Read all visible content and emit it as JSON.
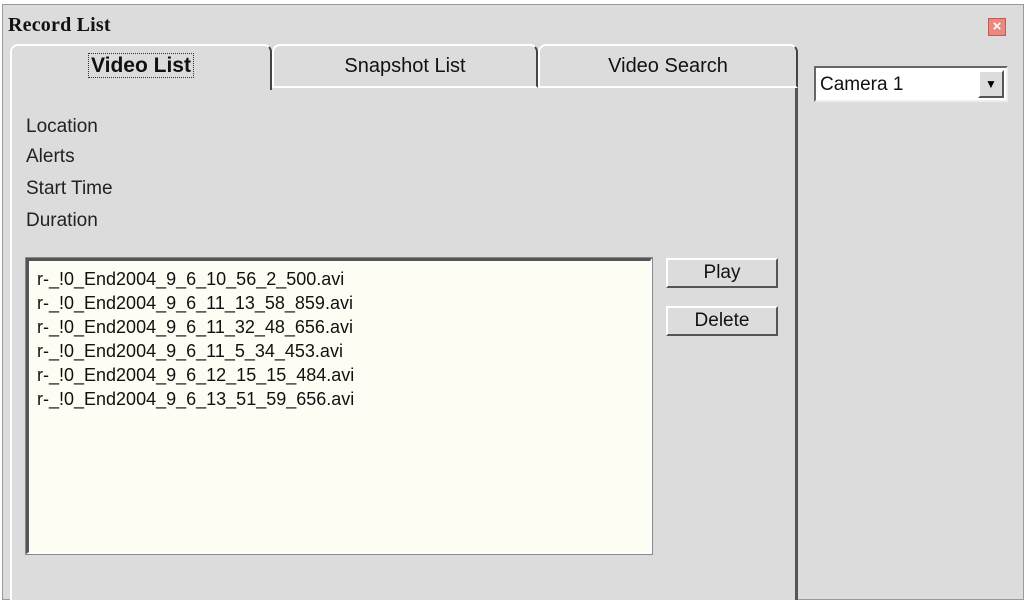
{
  "window": {
    "title": "Record List",
    "close_icon": "close-icon",
    "close_glyph": "×"
  },
  "tabs": [
    {
      "label": "Video List",
      "active": true
    },
    {
      "label": "Snapshot List",
      "active": false
    },
    {
      "label": "Video Search",
      "active": false
    }
  ],
  "info_labels": {
    "location": "Location",
    "alerts": "Alerts",
    "start_time": "Start Time",
    "duration": "Duration"
  },
  "files": [
    "r-_!0_End2004_9_6_10_56_2_500.avi",
    "r-_!0_End2004_9_6_11_13_58_859.avi",
    "r-_!0_End2004_9_6_11_32_48_656.avi",
    "r-_!0_End2004_9_6_11_5_34_453.avi",
    "r-_!0_End2004_9_6_12_15_15_484.avi",
    "r-_!0_End2004_9_6_13_51_59_656.avi"
  ],
  "buttons": {
    "play": "Play",
    "delete": "Delete"
  },
  "camera": {
    "selected": "Camera 1",
    "arrow_icon": "chevron-down-icon",
    "arrow_glyph": "▼"
  }
}
